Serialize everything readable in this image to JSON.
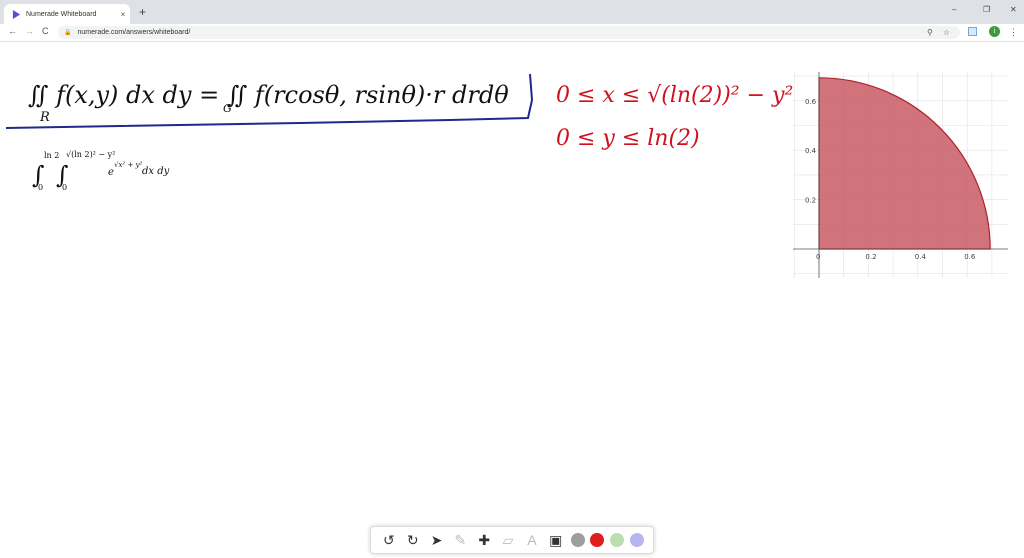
{
  "browser": {
    "tab_title": "Numerade Whiteboard",
    "tab_close": "×",
    "new_tab": "+",
    "window_controls": [
      "–",
      "❐",
      "✕"
    ],
    "nav": [
      "←",
      "→",
      "C"
    ],
    "url": "numerade.com/answers/whiteboard/",
    "lock": "🔒",
    "zoom_icon": "⚲",
    "star_icon": "☆",
    "avatar_initial": "i",
    "menu_icon": "⋮"
  },
  "whiteboard": {
    "typed_integral": {
      "int_sign": "∫",
      "outer_lower": "0",
      "outer_upper": "ln 2",
      "inner_lower": "0",
      "inner_upper": "√(ln 2)² − y²",
      "integrand_base": "e",
      "integrand_exp": "√x² + y²",
      "differentials": "dx dy"
    },
    "handwritten": {
      "formula": "∬ f(x,y) dx dy = ∬ f(rcosθ, rsinθ)·r drdθ",
      "region_R": "R",
      "region_G": "G",
      "bound_x": "0 ≤ x ≤ √(ln(2))² − y²",
      "bound_y": "0 ≤ y ≤ ln(2)"
    },
    "colors": {
      "ink_black": "#111111",
      "ink_blue": "#1f2a8c",
      "ink_red": "#d0101e",
      "region_fill": "#c85a64"
    }
  },
  "chart_data": {
    "type": "area",
    "description_shape": "quarter disk",
    "radius": 0.693,
    "x_ticks": [
      "0",
      "0.2",
      "0.4",
      "0.6"
    ],
    "y_ticks": [
      "0.2",
      "0.4",
      "0.6"
    ],
    "xlim": [
      -0.1,
      0.75
    ],
    "ylim": [
      -0.1,
      0.7
    ],
    "grid": true
  },
  "toolbar": {
    "tools": [
      "undo-icon",
      "redo-icon",
      "pointer-icon",
      "pen-icon",
      "plus-icon",
      "eraser-icon",
      "text-icon",
      "image-icon"
    ],
    "glyphs": [
      "↺",
      "↻",
      "➤",
      "✎",
      "✚",
      "▱",
      "A",
      "▣"
    ],
    "swatches": [
      "#9e9e9e",
      "#e01e1e",
      "#b9dfb1",
      "#b7b5ef"
    ]
  }
}
